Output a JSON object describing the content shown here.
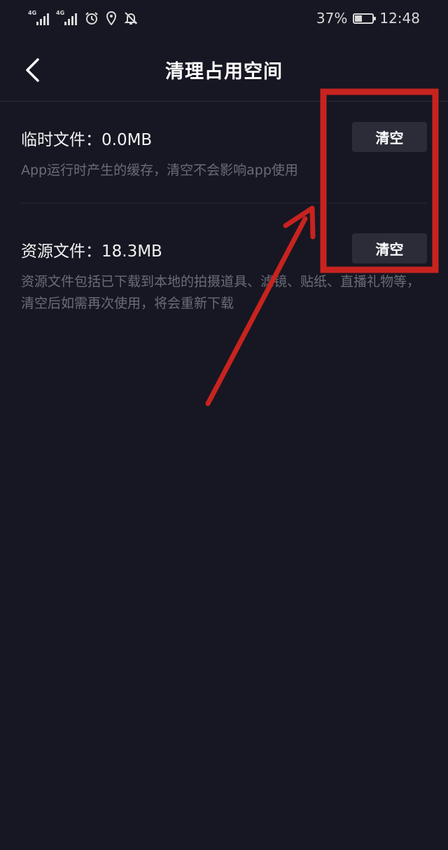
{
  "status_bar": {
    "network_1": "4G",
    "network_2": "4G",
    "battery_percent": "37%",
    "battery_level": 0.37,
    "time": "12:48"
  },
  "nav": {
    "title": "清理占用空间"
  },
  "items": [
    {
      "name": "临时文件：0.0MB",
      "description": "App运行时产生的缓存，清空不会影响app使用",
      "button": "清空"
    },
    {
      "name": "资源文件：18.3MB",
      "description": "资源文件包括已下载到本地的拍摄道具、滤镜、贴纸、直播礼物等，清空后如需再次使用，将会重新下载",
      "button": "清空"
    }
  ],
  "colors": {
    "background": "#161722",
    "button_bg": "#2b2c38",
    "annotation_red": "#c8231f",
    "secondary_text": "#6b6c78"
  }
}
